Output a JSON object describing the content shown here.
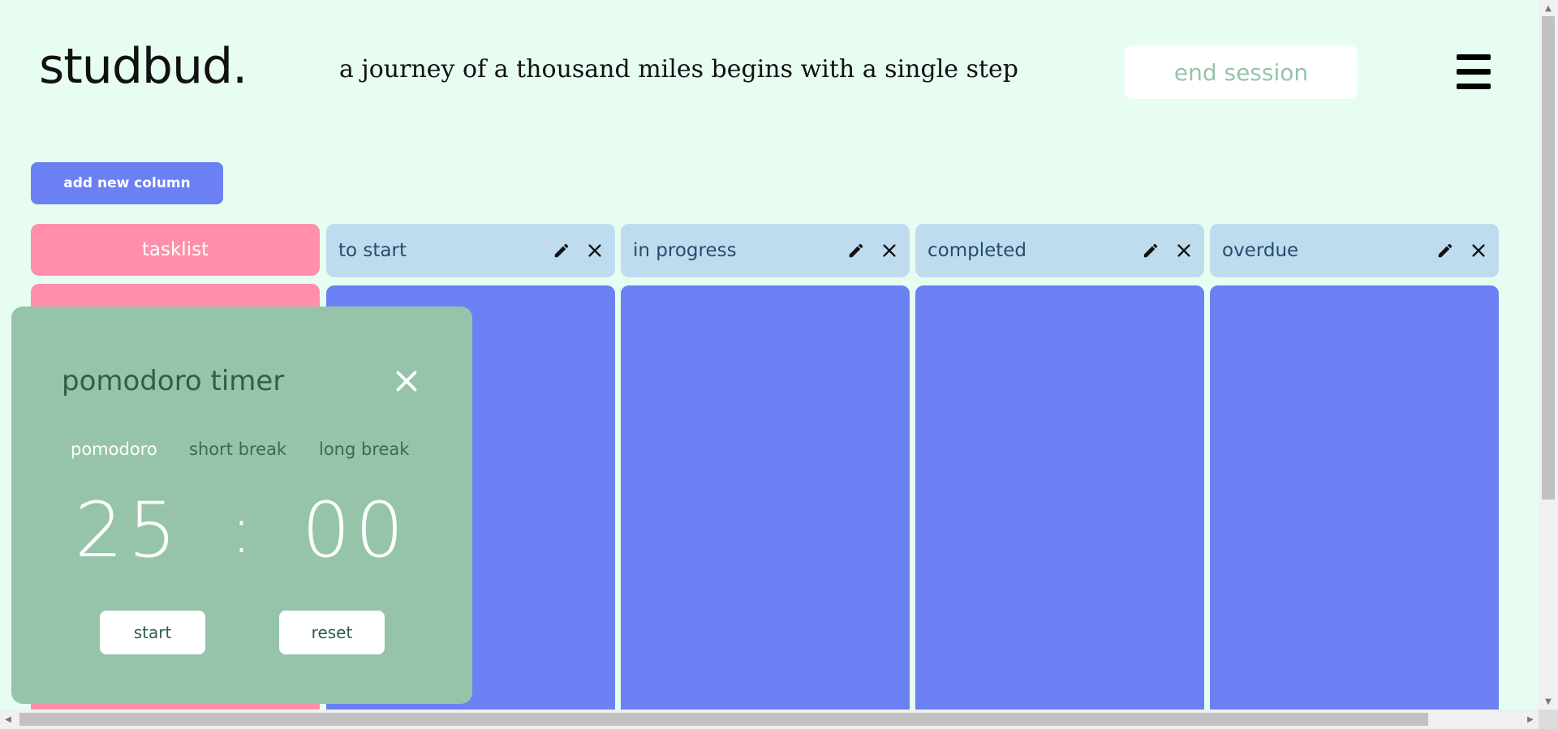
{
  "header": {
    "logo": "studbud.",
    "quote": "a journey of a thousand miles begins with a single step",
    "end_session_label": "end session",
    "menu_icon": "hamburger-menu-icon"
  },
  "board": {
    "add_column_label": "add new column",
    "tasklist_label": "tasklist",
    "columns": [
      {
        "title": "to start"
      },
      {
        "title": "in progress"
      },
      {
        "title": "completed"
      },
      {
        "title": "overdue"
      }
    ],
    "icons": {
      "edit": "pencil-icon",
      "delete": "close-icon"
    }
  },
  "pomodoro": {
    "title": "pomodoro timer",
    "modes": [
      "pomodoro",
      "short break",
      "long break"
    ],
    "active_mode": "pomodoro",
    "minutes": "25",
    "separator": ":",
    "seconds": "00",
    "start_label": "start",
    "reset_label": "reset"
  },
  "colors": {
    "background": "#e7fdf1",
    "accent_blue": "#6b81f3",
    "tasklist_pink": "#ff8fab",
    "column_header": "#bfdcee",
    "timer_green": "#96c4ab"
  }
}
